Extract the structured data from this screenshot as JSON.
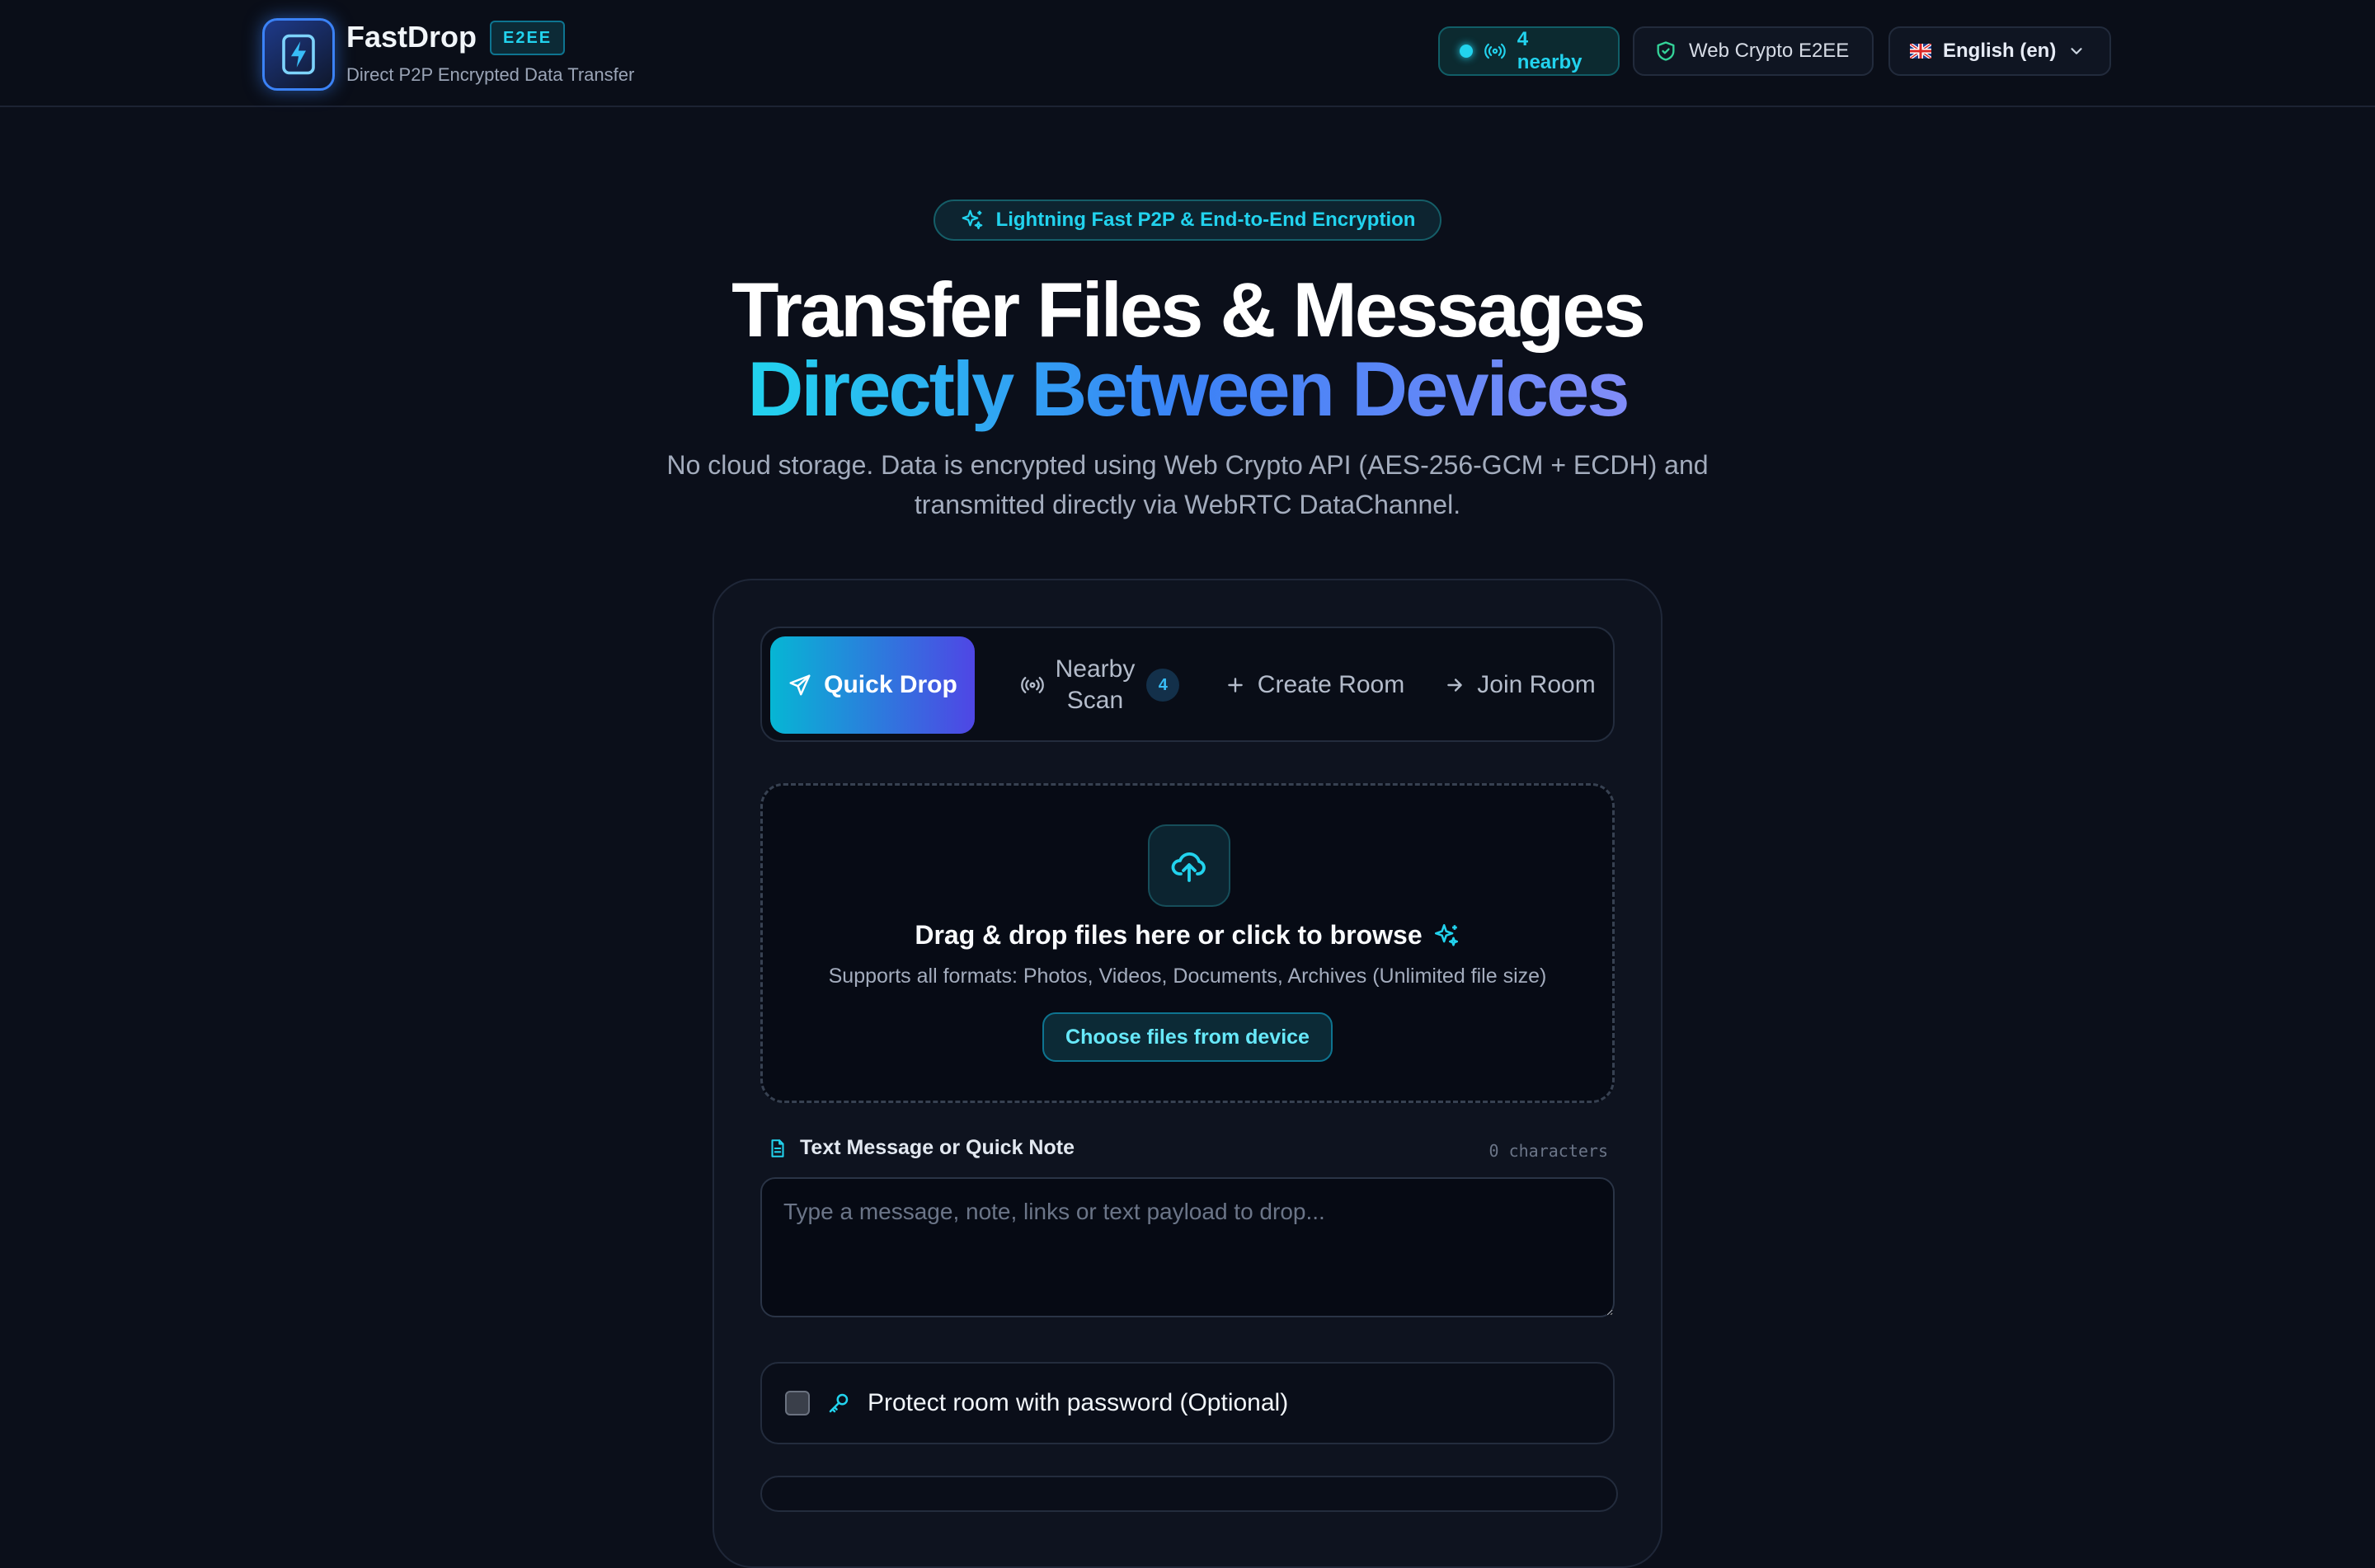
{
  "header": {
    "app_name": "FastDrop",
    "badge": "E2EE",
    "subtitle": "Direct P2P Encrypted Data Transfer",
    "nearby_status": "4 nearby",
    "crypto_status": "Web Crypto E2EE",
    "language": "English (en)"
  },
  "hero": {
    "tagline": "Lightning Fast P2P & End-to-End Encryption",
    "title_line1": "Transfer Files & Messages",
    "title_line2": "Directly Between Devices",
    "description": "No cloud storage. Data is encrypted using Web Crypto API (AES-256-GCM + ECDH) and transmitted directly via WebRTC DataChannel."
  },
  "tabs": {
    "quick_drop": "Quick Drop",
    "nearby_line1": "Nearby",
    "nearby_line2": "Scan",
    "nearby_count": "4",
    "create_room": "Create Room",
    "join_room": "Join Room",
    "active": "Quick Drop"
  },
  "dropzone": {
    "title": "Drag & drop files here or click to browse",
    "subtitle": "Supports all formats: Photos, Videos, Documents, Archives (Unlimited file size)",
    "button": "Choose files from device"
  },
  "message": {
    "label": "Text Message or Quick Note",
    "char_count": "0 characters",
    "value": "",
    "placeholder": "Type a message, note, links or text payload to drop..."
  },
  "password": {
    "label": "Protect room with password (Optional)",
    "checked": false
  },
  "icons": {
    "logo": "lightning-bolt-icon",
    "nearby": "radio-waves-icon",
    "crypto": "shield-check-icon",
    "language": "uk-flag-icon",
    "dropdown": "chevron-down-icon",
    "tagline": "sparkles-icon",
    "quick_drop": "send-icon",
    "create": "plus-icon",
    "join": "arrow-right-icon",
    "upload": "cloud-upload-icon",
    "message": "document-icon",
    "password": "key-icon"
  },
  "colors": {
    "background": "#0b0f1a",
    "accent_cyan": "#22d3ee",
    "accent_blue": "#3b82f6",
    "accent_indigo": "#818cf8"
  }
}
